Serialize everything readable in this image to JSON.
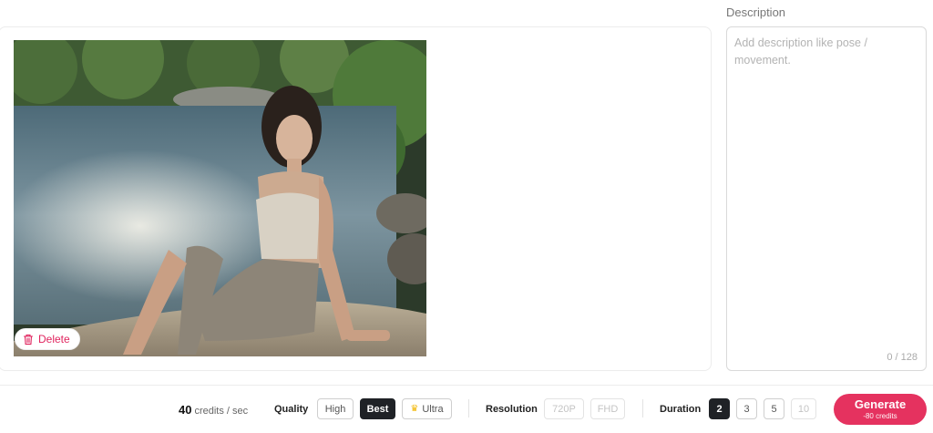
{
  "image_panel": {
    "delete_label": "Delete"
  },
  "description": {
    "label": "Description",
    "placeholder": "Add description like pose / movement.",
    "value": "",
    "counter": "0 / 128"
  },
  "footer": {
    "credits_value": "40",
    "credits_unit": "credits / sec",
    "quality": {
      "label": "Quality",
      "options": [
        "High",
        "Best",
        "Ultra"
      ],
      "selected": "Best"
    },
    "resolution": {
      "label": "Resolution",
      "options": [
        "720P",
        "FHD"
      ]
    },
    "duration": {
      "label": "Duration",
      "options": [
        "2",
        "3",
        "5",
        "10"
      ],
      "selected": "2"
    },
    "generate": {
      "label": "Generate",
      "cost": "-80 credits"
    }
  },
  "colors": {
    "accent": "#e5325f",
    "active_option": "#1f2226",
    "ultra_crown": "#f2b705"
  }
}
